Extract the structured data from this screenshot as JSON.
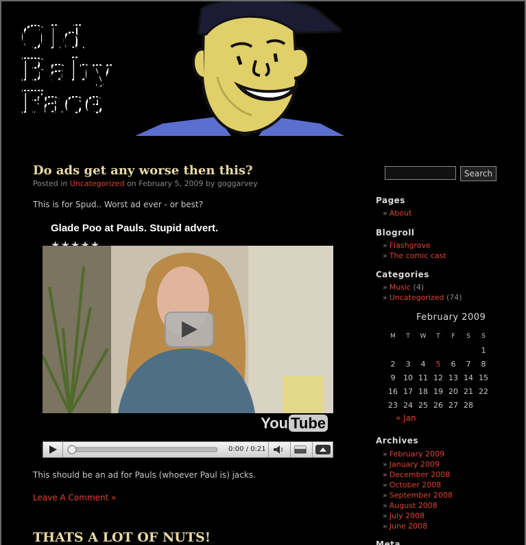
{
  "site": {
    "logo_lines": [
      "Old",
      "Baby",
      "Face"
    ]
  },
  "post1": {
    "title": "Do ads get any worse then this?",
    "meta_prefix": "Posted in",
    "meta_category": "Uncategorized",
    "meta_suffix": "on February 5, 2009 by goggarvey",
    "intro": "This is for Spud.. Worst ad ever - or best?",
    "video": {
      "title": "Glade Poo at Pauls. Stupid advert.",
      "stars": "★★★★★",
      "time": "0:00 / 0:21",
      "yt_you": "You",
      "yt_tube": "Tube"
    },
    "body": "This should be an ad for Pauls (whoever Paul is) jacks.",
    "comment_link": "Leave A Comment »"
  },
  "post2": {
    "title": "THATS A LOT OF NUTS!"
  },
  "sidebar": {
    "search_button": "Search",
    "pages_heading": "Pages",
    "pages": [
      {
        "label": "About"
      }
    ],
    "blogroll_heading": "Blogroll",
    "blogroll": [
      {
        "label": "Flashgrove"
      },
      {
        "label": "The comic cast"
      }
    ],
    "categories_heading": "Categories",
    "categories": [
      {
        "label": "Music",
        "count": "(4)"
      },
      {
        "label": "Uncategorized",
        "count": "(74)"
      }
    ],
    "calendar": {
      "caption": "February 2009",
      "days": [
        "M",
        "T",
        "W",
        "T",
        "F",
        "S",
        "S"
      ],
      "weeks": [
        [
          "",
          "",
          "",
          "",
          "",
          "",
          "1"
        ],
        [
          "2",
          "3",
          "4",
          "5",
          "6",
          "7",
          "8"
        ],
        [
          "9",
          "10",
          "11",
          "12",
          "13",
          "14",
          "15"
        ],
        [
          "16",
          "17",
          "18",
          "19",
          "20",
          "21",
          "22"
        ],
        [
          "23",
          "24",
          "25",
          "26",
          "27",
          "28",
          ""
        ]
      ],
      "linked_day": "5",
      "prev": "« Jan"
    },
    "archives_heading": "Archives",
    "archives": [
      {
        "label": "February 2009"
      },
      {
        "label": "January 2009"
      },
      {
        "label": "December 2008"
      },
      {
        "label": "October 2008"
      },
      {
        "label": "September 2008"
      },
      {
        "label": "August 2008"
      },
      {
        "label": "July 2008"
      },
      {
        "label": "June 2008"
      }
    ],
    "meta_heading": "Meta"
  },
  "colors": {
    "background": "#000000",
    "link": "#e0442e",
    "title": "#e8d9a6",
    "text": "#c8c8c8"
  }
}
